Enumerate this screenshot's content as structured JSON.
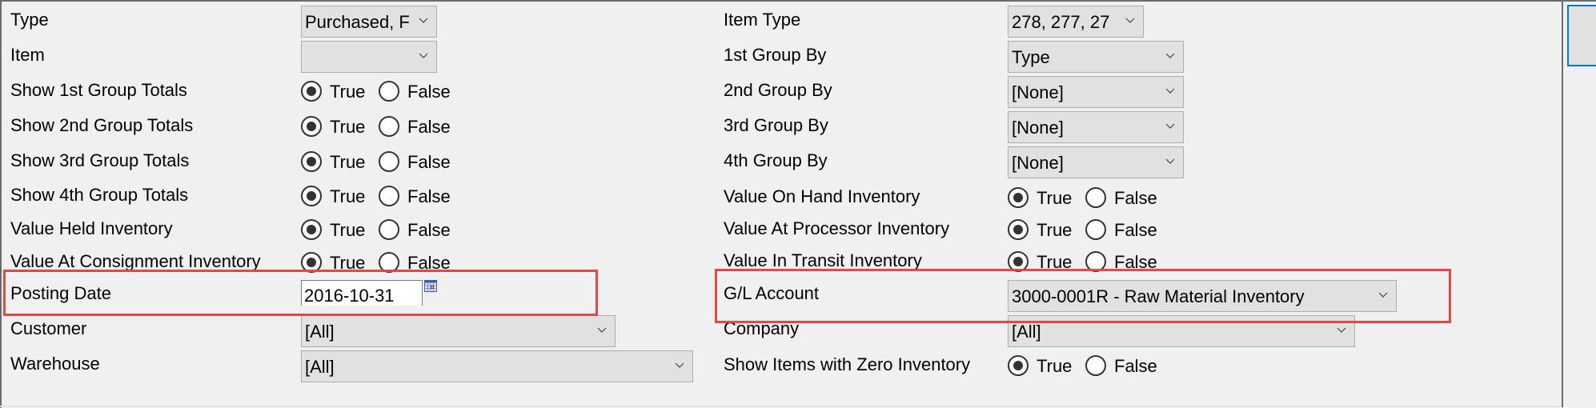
{
  "left_fields": {
    "type": {
      "label": "Type",
      "value": "Purchased, F"
    },
    "item": {
      "label": "Item",
      "value": ""
    },
    "show_1st_group_totals": {
      "label": "Show 1st Group Totals",
      "selected": "True"
    },
    "show_2nd_group_totals": {
      "label": "Show 2nd Group Totals",
      "selected": "True"
    },
    "show_3rd_group_totals": {
      "label": "Show 3rd Group Totals",
      "selected": "True"
    },
    "show_4th_group_totals": {
      "label": "Show 4th Group Totals",
      "selected": "True"
    },
    "value_held_inventory": {
      "label": "Value Held Inventory",
      "selected": "True"
    },
    "value_at_consignment_inventory": {
      "label": "Value At Consignment Inventory",
      "selected": "True"
    },
    "posting_date": {
      "label": "Posting Date",
      "value": "2016-10-31"
    },
    "customer": {
      "label": "Customer",
      "value": "[All]"
    },
    "warehouse": {
      "label": "Warehouse",
      "value": "[All]"
    }
  },
  "right_fields": {
    "item_type": {
      "label": "Item Type",
      "value": "278, 277, 27"
    },
    "group_by_1": {
      "label": "1st Group By",
      "value": "Type"
    },
    "group_by_2": {
      "label": "2nd Group By",
      "value": "[None]"
    },
    "group_by_3": {
      "label": "3rd Group By",
      "value": "[None]"
    },
    "group_by_4": {
      "label": "4th Group By",
      "value": "[None]"
    },
    "value_on_hand_inventory": {
      "label": "Value On Hand Inventory",
      "selected": "True"
    },
    "value_at_processor_inventory": {
      "label": "Value At Processor Inventory",
      "selected": "True"
    },
    "value_in_transit_inventory": {
      "label": "Value In Transit Inventory",
      "selected": "True"
    },
    "gl_account": {
      "label": "G/L Account",
      "value": "3000-0001R - Raw Material Inventory"
    },
    "company": {
      "label": "Company",
      "value": "[All]"
    },
    "show_items_zero_inventory": {
      "label": "Show Items with Zero Inventory",
      "selected": "True"
    }
  },
  "radio_options": {
    "true_label": "True",
    "false_label": "False"
  },
  "icons": {
    "dropdown": "chevron-down-icon",
    "calendar": "calendar-icon"
  },
  "colors": {
    "highlight": "#e04a44",
    "focus_border": "#0078d7"
  }
}
